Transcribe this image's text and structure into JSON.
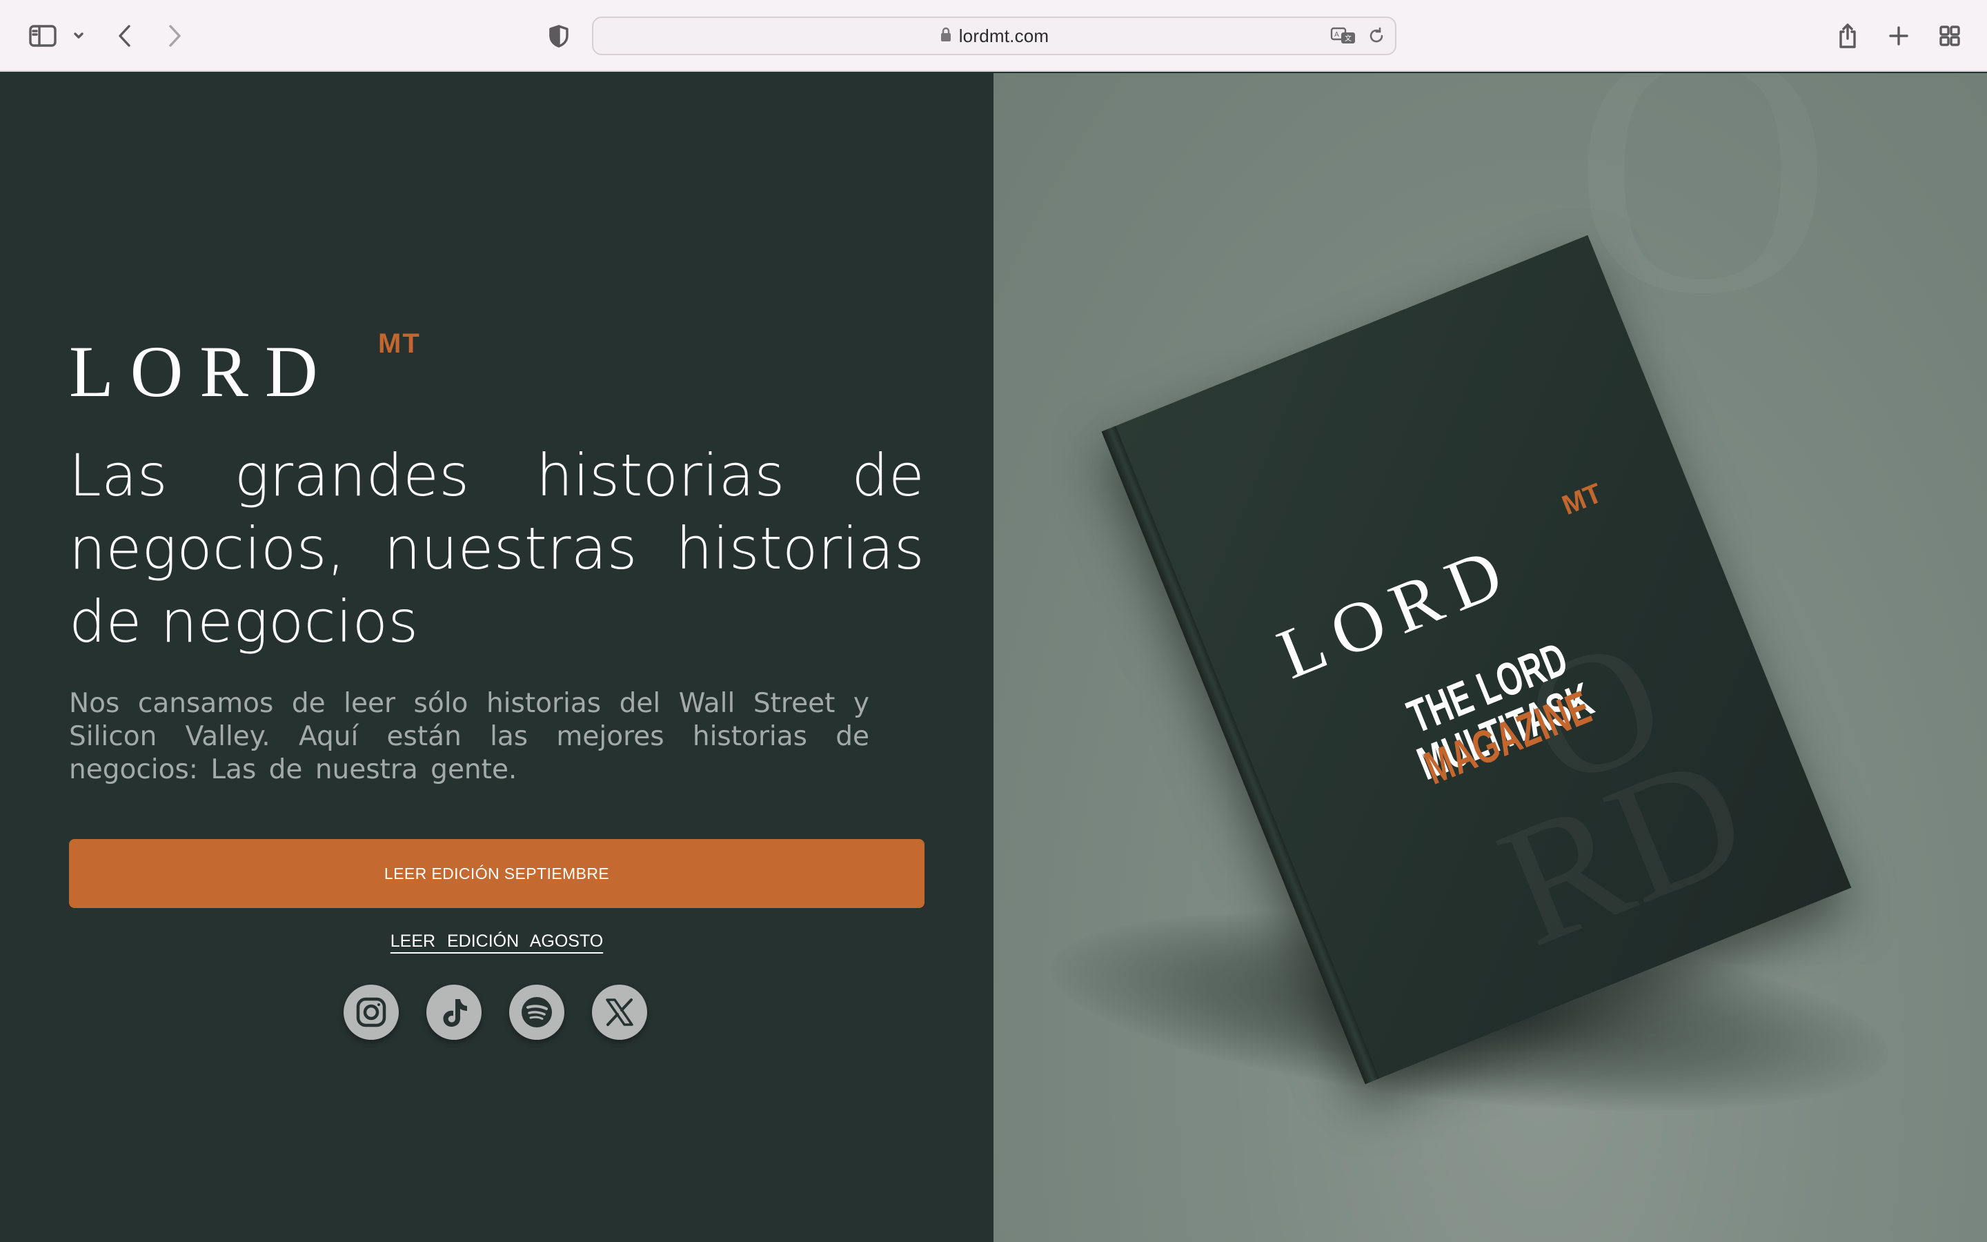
{
  "browser": {
    "url": "lordmt.com"
  },
  "hero": {
    "logo_main": "LORD",
    "logo_super": "MT",
    "headline": "Las grandes historias de negocios, nuestras historias de negocios",
    "subtext": "Nos cansamos de leer sólo historias del Wall Street y Silicon Valley. Aquí están las mejores historias de negocios: Las de nuestra gente.",
    "primary_button": "LEER EDICIÓN SEPTIEMBRE",
    "secondary_link": "LEER EDICIÓN AGOSTO",
    "social": [
      "instagram-icon",
      "tiktok-icon",
      "spotify-icon",
      "x-icon"
    ]
  },
  "magazine": {
    "logo_main": "LORD",
    "logo_super": "MT",
    "title": "THE LORD MULTITASK",
    "subtitle": "MAGAZINE"
  },
  "colors": {
    "accent": "#c4692f",
    "dark_green": "#26322f",
    "sage": "#7d8a83"
  }
}
